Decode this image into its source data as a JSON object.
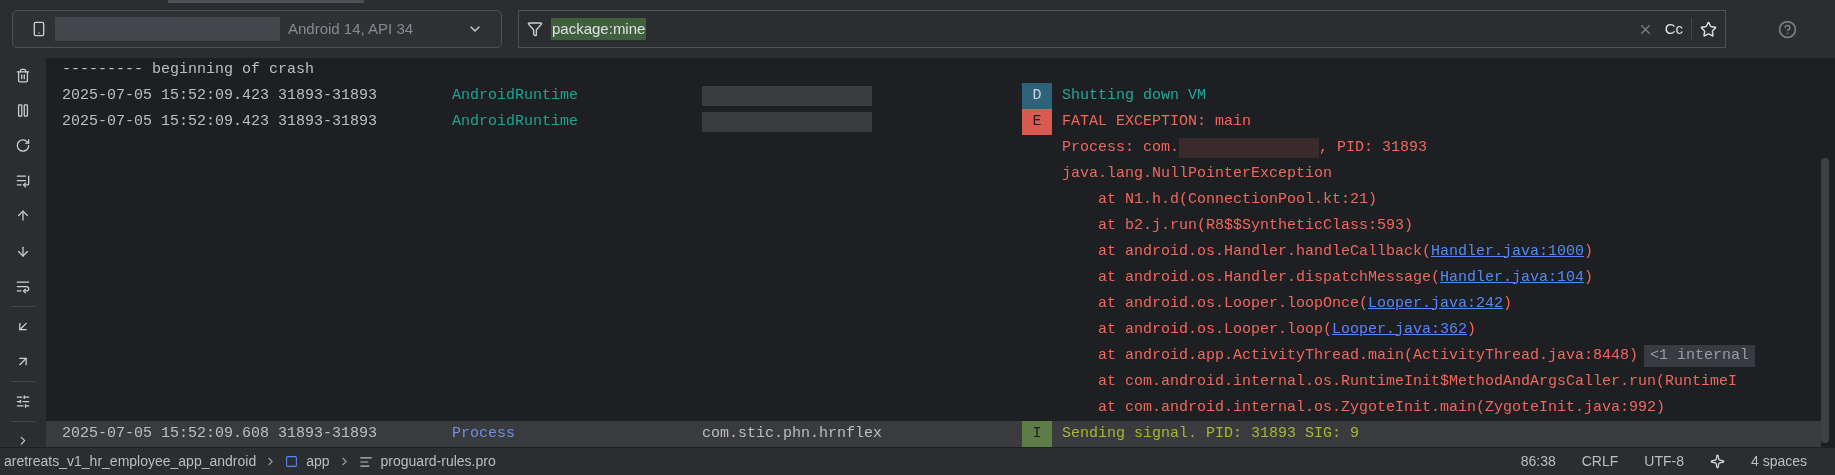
{
  "device_selector": {
    "label": "Android 14, API 34"
  },
  "filter": {
    "value": "package:mine",
    "value_selected": true,
    "case_button": "Cc"
  },
  "log": [
    {
      "kind": "separator",
      "text": "--------- beginning of crash"
    },
    {
      "kind": "log",
      "selected": false,
      "timestamp": "2025-07-05 15:52:09.423",
      "pids": "31893-31893",
      "tag": {
        "text": "AndroidRuntime",
        "color": "#1fa392"
      },
      "package": {
        "kind": "redacted"
      },
      "level": {
        "text": "D",
        "kind": "debug"
      },
      "lines": [
        {
          "parts": [
            {
              "kind": "text",
              "text": "Shutting down VM"
            }
          ]
        }
      ]
    },
    {
      "kind": "log",
      "selected": false,
      "timestamp": "2025-07-05 15:52:09.423",
      "pids": "31893-31893",
      "tag": {
        "text": "AndroidRuntime",
        "color": "#1fa392"
      },
      "package": {
        "kind": "redacted"
      },
      "level": {
        "text": "E",
        "kind": "error"
      },
      "lines": [
        {
          "parts": [
            {
              "kind": "text",
              "text": "FATAL EXCEPTION: main"
            }
          ]
        },
        {
          "parts": [
            {
              "kind": "text",
              "text": "Process: com."
            },
            {
              "kind": "redacted"
            },
            {
              "kind": "text",
              "text": ", PID: 31893"
            }
          ]
        },
        {
          "parts": [
            {
              "kind": "text",
              "text": "java.lang.NullPointerException"
            }
          ],
          "children": [
            {
              "parts": [
                {
                  "kind": "text",
                  "text": "at N1.h.d(ConnectionPool.kt:21)"
                }
              ]
            },
            {
              "parts": [
                {
                  "kind": "text",
                  "text": "at b2.j.run(R8$$SyntheticClass:593)"
                }
              ]
            },
            {
              "parts": [
                {
                  "kind": "text",
                  "text": "at android.os.Handler.handleCallback("
                },
                {
                  "kind": "link",
                  "text": "Handler.java:1000"
                },
                {
                  "kind": "text",
                  "text": ")"
                }
              ]
            },
            {
              "parts": [
                {
                  "kind": "text",
                  "text": "at android.os.Handler.dispatchMessage("
                },
                {
                  "kind": "link",
                  "text": "Handler.java:104"
                },
                {
                  "kind": "text",
                  "text": ")"
                }
              ]
            },
            {
              "parts": [
                {
                  "kind": "text",
                  "text": "at android.os.Looper.loopOnce("
                },
                {
                  "kind": "link",
                  "text": "Looper.java:242"
                },
                {
                  "kind": "text",
                  "text": ")"
                }
              ]
            },
            {
              "parts": [
                {
                  "kind": "text",
                  "text": "at android.os.Looper.loop("
                },
                {
                  "kind": "link",
                  "text": "Looper.java:362"
                },
                {
                  "kind": "text",
                  "text": ")"
                }
              ]
            },
            {
              "parts": [
                {
                  "kind": "text",
                  "text": "at android.app.ActivityThread.main(ActivityThread.java:8448)"
                },
                {
                  "kind": "fold",
                  "text": "<1 internal"
                }
              ]
            },
            {
              "parts": [
                {
                  "kind": "text",
                  "text": "at com.android.internal.os.RuntimeInit$MethodAndArgsCaller.run(RuntimeI"
                }
              ]
            },
            {
              "parts": [
                {
                  "kind": "text",
                  "text": "at com.android.internal.os.ZygoteInit.main(ZygoteInit.java:992)"
                }
              ]
            }
          ]
        }
      ]
    },
    {
      "kind": "log",
      "selected": true,
      "timestamp": "2025-07-05 15:52:09.608",
      "pids": "31893-31893",
      "tag": {
        "text": "Process",
        "color": "#6b93e0"
      },
      "package": {
        "kind": "text",
        "text": "com.stic.phn.hrnflex"
      },
      "level": {
        "text": "I",
        "kind": "info"
      },
      "lines": [
        {
          "parts": [
            {
              "kind": "text",
              "text": "Sending signal. PID: 31893 SIG: 9"
            }
          ]
        }
      ]
    }
  ],
  "status_bar": {
    "breadcrumbs": [
      {
        "kind": "project",
        "text": "aretreats_v1_hr_employee_app_android"
      },
      {
        "kind": "module",
        "text": "app"
      },
      {
        "kind": "file",
        "text": "proguard-rules.pro"
      }
    ],
    "position": "86:38",
    "line_ending": "CRLF",
    "encoding": "UTF-8",
    "indent": "4 spaces"
  }
}
